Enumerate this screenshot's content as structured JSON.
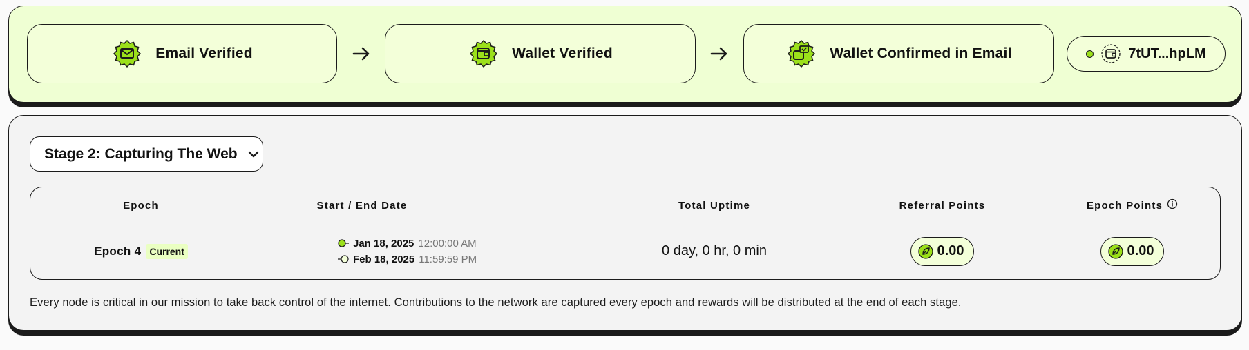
{
  "verification": {
    "steps": [
      {
        "label": "Email Verified",
        "icon": "email-badge-icon"
      },
      {
        "label": "Wallet Verified",
        "icon": "wallet-badge-icon"
      },
      {
        "label": "Wallet Confirmed in Email",
        "icon": "wallet-confirm-badge-icon"
      }
    ],
    "arrow_icon": "arrow-right-icon",
    "wallet": {
      "address": "7tUT...hpLM",
      "status": "connected",
      "icon": "wallet-icon"
    }
  },
  "stage": {
    "selector_label": "Stage 2: Capturing The Web",
    "selector_icon": "chevron-down-icon"
  },
  "table": {
    "headers": [
      "Epoch",
      "Start / End Date",
      "Total Uptime",
      "Referral Points",
      "Epoch Points"
    ],
    "info_icon": "info-icon",
    "rows": [
      {
        "epoch": "Epoch 4",
        "badge": "Current",
        "start_date": "Jan 18, 2025",
        "start_time": "12:00:00 AM",
        "end_date": "Feb 18, 2025",
        "end_time": "11:59:59 PM",
        "uptime": "0 day, 0 hr, 0 min",
        "referral_points": "0.00",
        "epoch_points": "0.00"
      }
    ]
  },
  "footnote": "Every node is critical in our mission to take back control of the internet. Contributions to the network are captured every epoch and rewards will be distributed at the end of each stage.",
  "colors": {
    "accent": "#9be01a",
    "panel_bg": "#efffd3",
    "chip_bg": "#f3ffd9",
    "border": "#1b1b1b",
    "stage_bg": "#f3f3f3"
  }
}
